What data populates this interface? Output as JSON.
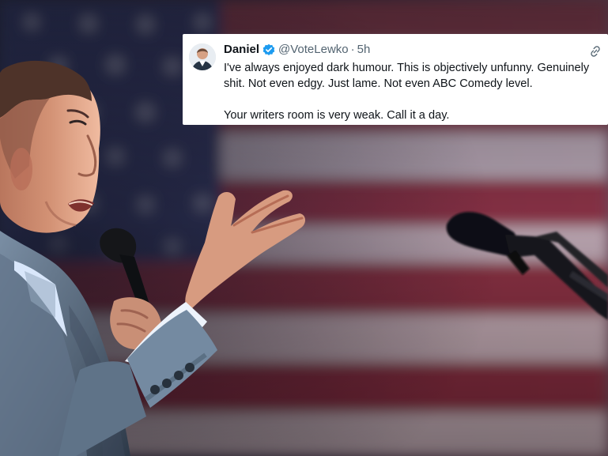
{
  "tweet": {
    "display_name": "Daniel",
    "handle": "@VoteLewko",
    "separator": "·",
    "time": "5h",
    "paragraphs": [
      "I've always enjoyed dark humour. This is objectively unfunny. Genuinely shit. Not even edgy. Just lame. Not even ABC Comedy level.",
      "Your writers room is very weak. Call it a day."
    ],
    "icons": {
      "verified": "verified-check-icon",
      "share": "share-link-icon"
    },
    "colors": {
      "verified": "#1d9bf0",
      "text": "#0f1419",
      "muted": "#536471"
    }
  },
  "scene": {
    "background": "american-flag",
    "subject": "man-speaking-into-microphone",
    "props": [
      "handheld-microphone",
      "podium-microphone"
    ]
  }
}
